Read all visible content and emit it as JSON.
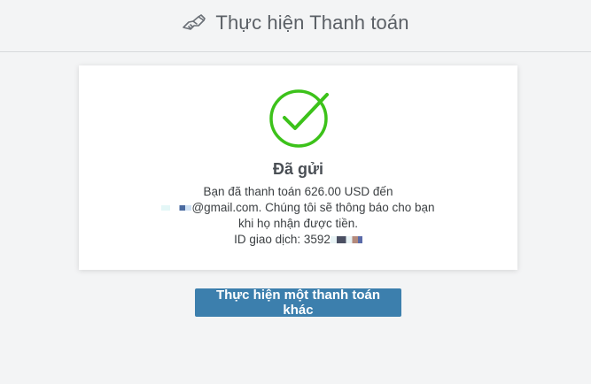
{
  "header": {
    "title": "Thực hiện Thanh toán",
    "icon": "handshake-icon"
  },
  "result": {
    "icon": "check-circle-icon",
    "status_color": "#3cc21a",
    "title": "Đã gửi",
    "line1": "Bạn đã thanh toán 626.00 USD đến",
    "line2": "@gmail.com. Chúng tôi sẽ thông báo cho bạn",
    "line3": "khi họ nhận được tiền.",
    "line4": "ID giao dịch: 3592"
  },
  "actions": {
    "another_payment_label": "Thực hiện một thanh toán khác",
    "button_color": "#3c7fad"
  }
}
